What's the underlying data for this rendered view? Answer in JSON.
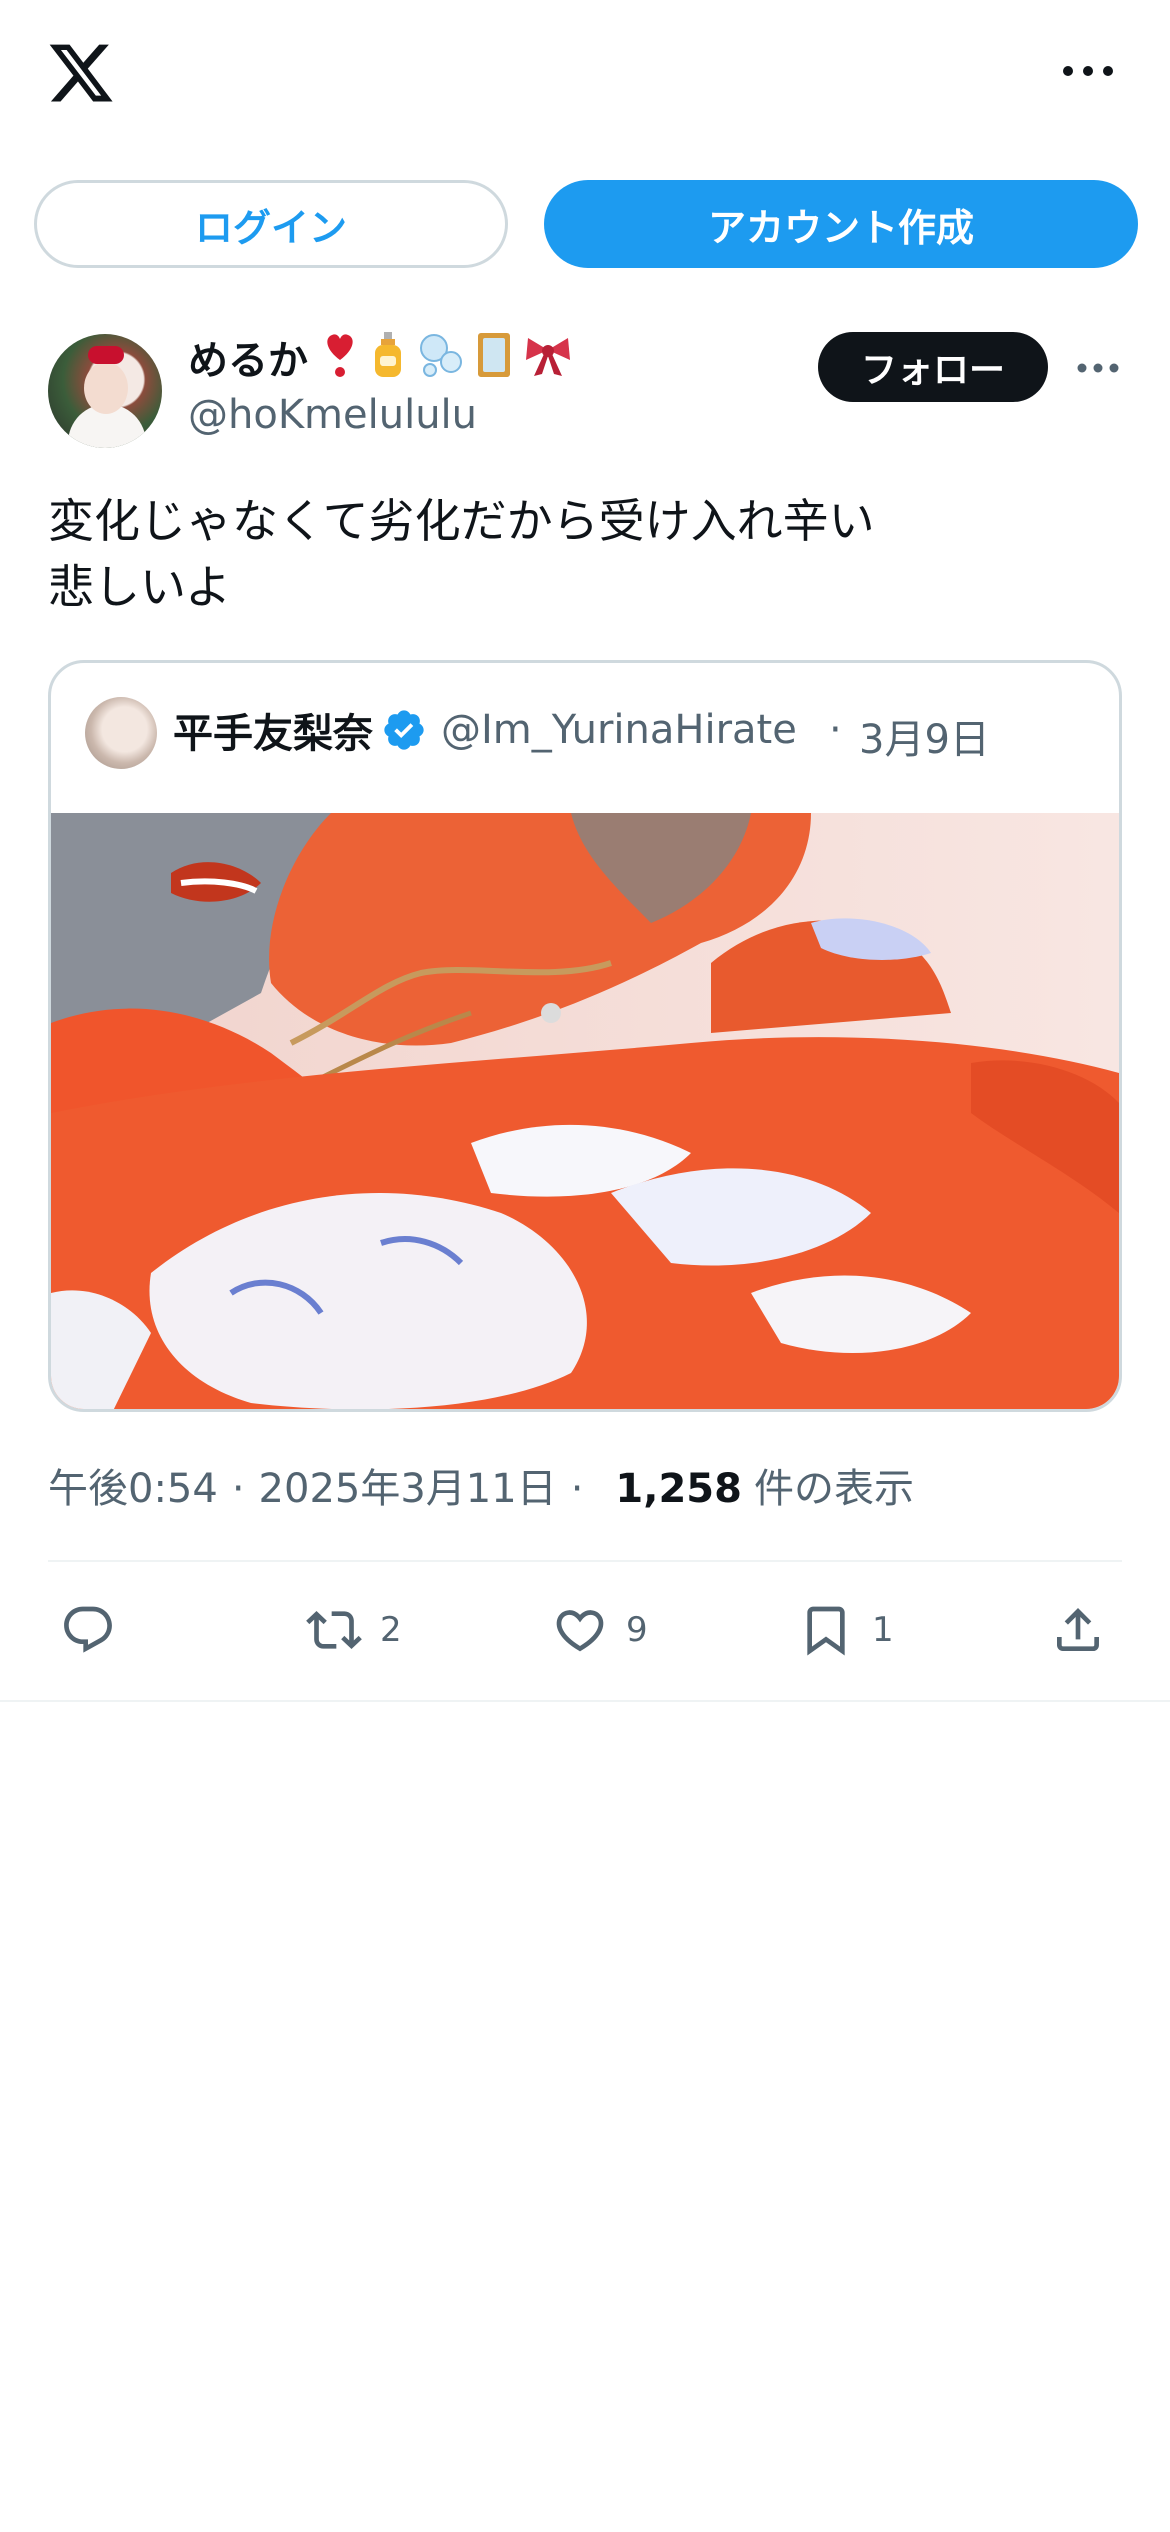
{
  "topbar": {
    "login_label": "ログイン",
    "signup_label": "アカウント作成"
  },
  "post": {
    "author": {
      "display_name": "めるか",
      "emojis": [
        "heart-exclamation",
        "lotion-bottle",
        "bubbles",
        "mirror",
        "ribbon"
      ],
      "handle": "@hoKmelululu",
      "follow_label": "フォロー"
    },
    "text_line1": "変化じゃなくて劣化だから受け入れ辛い",
    "text_line2": "悲しいよ",
    "quote": {
      "display_name": "平手友梨奈",
      "verified": true,
      "handle": "@Im_YurinaHirate",
      "separator": "·",
      "date": "3月9日"
    },
    "meta": {
      "time": "午後0:54",
      "separator": "·",
      "date": "2025年3月11日",
      "views_count": "1,258",
      "views_label": "件の表示"
    },
    "actions": {
      "reply_count": "",
      "repost_count": "2",
      "like_count": "9",
      "bookmark_count": "1"
    }
  },
  "colors": {
    "accent": "#1d9bf0",
    "text": "#0f1419",
    "secondary": "#536471",
    "border": "#cfd9de"
  }
}
